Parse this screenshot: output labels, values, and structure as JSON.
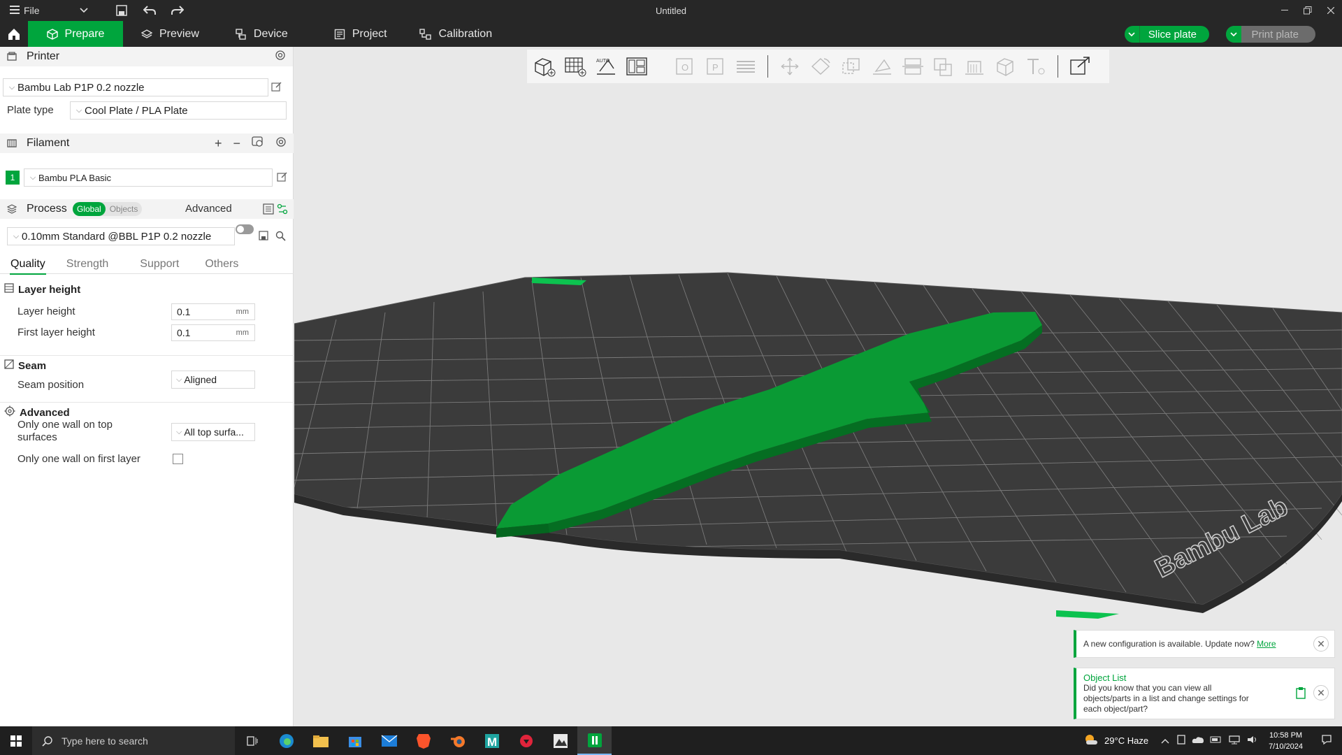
{
  "titlebar": {
    "file_label": "File",
    "title": "Untitled"
  },
  "nav": {
    "tabs": [
      {
        "label": "Prepare",
        "icon": "cube-icon"
      },
      {
        "label": "Preview",
        "icon": "layers-icon"
      },
      {
        "label": "Device",
        "icon": "device-icon"
      },
      {
        "label": "Project",
        "icon": "project-icon"
      },
      {
        "label": "Calibration",
        "icon": "calibration-icon"
      }
    ],
    "slice_label": "Slice plate",
    "print_label": "Print plate"
  },
  "printer": {
    "section_label": "Printer",
    "selected": "Bambu Lab P1P 0.2 nozzle",
    "plate_type_label": "Plate type",
    "plate_type": "Cool Plate / PLA Plate"
  },
  "filament": {
    "section_label": "Filament",
    "slot_number": "1",
    "selected": "Bambu PLA Basic",
    "slot_color": "#00a53d"
  },
  "process": {
    "section_label": "Process",
    "global_label": "Global",
    "objects_label": "Objects",
    "advanced_label": "Advanced",
    "preset": "0.10mm Standard @BBL P1P 0.2 nozzle",
    "tabs": [
      "Quality",
      "Strength",
      "Support",
      "Others"
    ]
  },
  "quality": {
    "layer_height_group": "Layer height",
    "layer_height_label": "Layer height",
    "layer_height_value": "0.1",
    "first_layer_height_label": "First layer height",
    "first_layer_height_value": "0.1",
    "unit": "mm",
    "seam_group": "Seam",
    "seam_position_label": "Seam position",
    "seam_position_value": "Aligned",
    "advanced_group": "Advanced",
    "one_wall_top_label_1": "Only one wall on top",
    "one_wall_top_label_2": "surfaces",
    "one_wall_top_value": "All top surfa...",
    "one_wall_first_label": "Only one wall on first layer"
  },
  "notifications": {
    "config_text": "A new configuration is available. Update now?",
    "config_link": "More",
    "tip_title": "Object List",
    "tip_line1": "Did you know that you can view all",
    "tip_line2": "objects/parts in a list and change settings for",
    "tip_line3": "each object/part?"
  },
  "bed": {
    "brand_text": "Bambu Lab",
    "accent": "#00a53d",
    "model_color": "#078a2c"
  },
  "taskbar": {
    "search_placeholder": "Type here to search",
    "weather": "29°C  Haze",
    "time": "10:58 PM",
    "date": "7/10/2024"
  }
}
